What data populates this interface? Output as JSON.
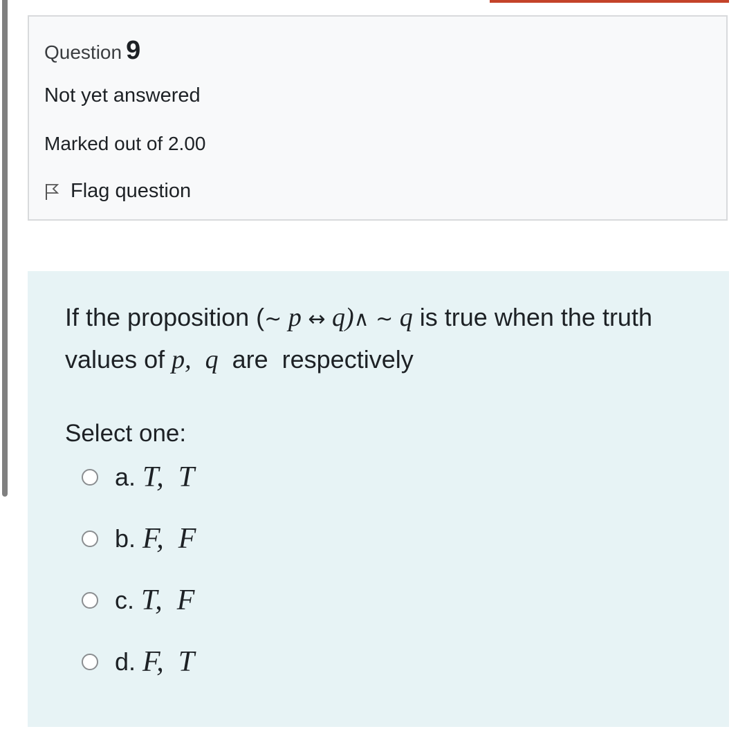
{
  "info": {
    "question_label": "Question",
    "question_number": "9",
    "state": "Not yet answered",
    "grade": "Marked out of 2.00",
    "flag_label": "Flag question"
  },
  "question": {
    "text_1": "If the proposition (",
    "tilde_1": "~",
    "p_1": " p ",
    "arrow": "↔",
    "q_1": " q",
    "close_paren": ")",
    "and_sym": "∧",
    "tilde_2": " ~ ",
    "q_2": "q",
    "text_2": " is true when the truth values of ",
    "p_2": "p,",
    "gap": "  ",
    "q_3": "q",
    "text_3": "  are  respectively"
  },
  "prompt": "Select one:",
  "options": [
    {
      "letter": "a.",
      "value": "T,  T"
    },
    {
      "letter": "b.",
      "value": "F,  F"
    },
    {
      "letter": "c.",
      "value": "T,  F"
    },
    {
      "letter": "d.",
      "value": "F,  T"
    }
  ]
}
